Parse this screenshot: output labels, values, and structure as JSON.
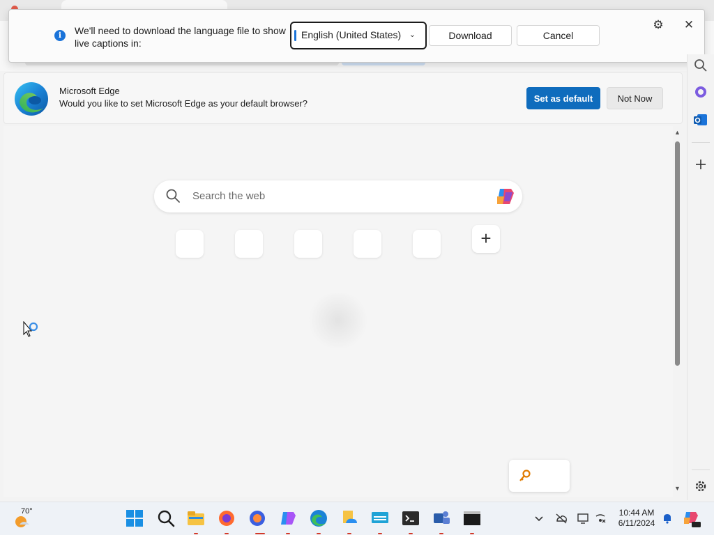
{
  "captions_dialog": {
    "message": "We'll need to download the language file to show live captions in:",
    "language_selected": "English (United States)",
    "download_label": "Download",
    "cancel_label": "Cancel",
    "icons": [
      "info-icon",
      "chevron-down-icon",
      "gear-icon",
      "close-icon"
    ]
  },
  "default_browser_bar": {
    "title": "Microsoft Edge",
    "description": "Would you like to set Microsoft Edge as your default browser?",
    "set_default_label": "Set as default",
    "not_now_label": "Not Now"
  },
  "new_tab": {
    "search_placeholder": "Search the web",
    "quick_link_count": 5,
    "add_tile_label": "+"
  },
  "taskbar": {
    "weather_temp": "70°",
    "time": "10:44 AM",
    "date": "6/11/2024",
    "apps": [
      "start-icon",
      "search-icon",
      "file-explorer-icon",
      "firefox-icon",
      "firefox-dev-icon",
      "copilot-icon",
      "edge-icon",
      "onedrive-icon",
      "remote-desktop-icon",
      "terminal-icon",
      "teams-icon",
      "cmd-icon"
    ],
    "tray": [
      "chevron-up-icon",
      "cloud-icon",
      "display-icon",
      "network-icon",
      "bell-icon",
      "copilot-pre-icon"
    ]
  },
  "colors": {
    "accent": "#0f6cbd",
    "info": "#1a73d9",
    "taskbar": "#eef2f7"
  }
}
